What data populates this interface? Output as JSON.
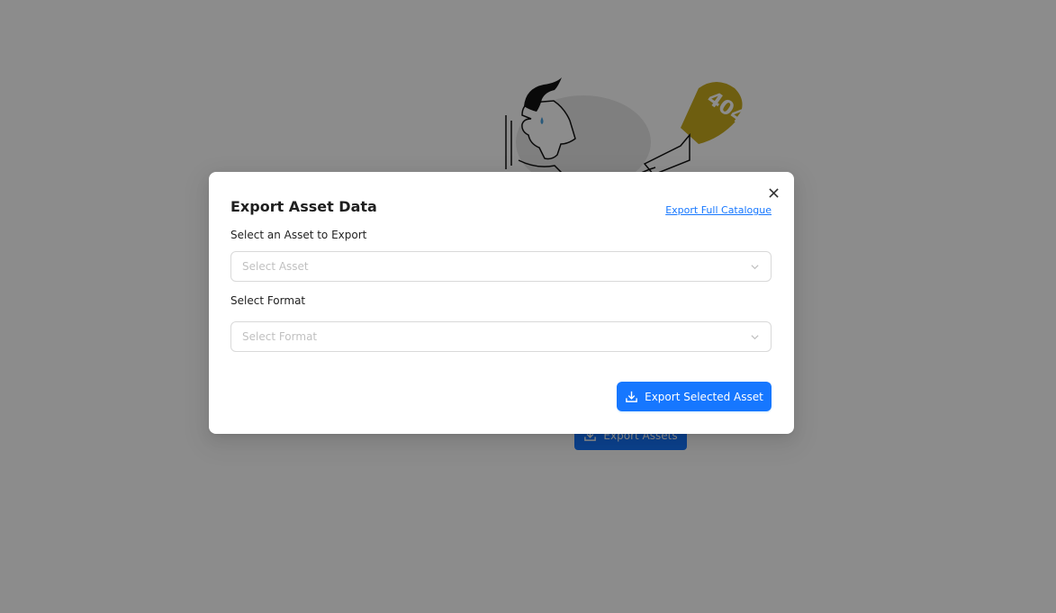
{
  "background": {
    "illustration_text": "404",
    "export_assets_label": "Export Assets",
    "export_icon": "download-icon"
  },
  "modal": {
    "title": "Export Asset Data",
    "full_catalogue_link": "Export Full Catalogue",
    "close_icon": "close-icon",
    "asset_field": {
      "label": "Select an Asset to Export",
      "placeholder": "Select Asset"
    },
    "format_field": {
      "label": "Select Format",
      "placeholder": "Select Format"
    },
    "export_selected_label": "Export Selected Asset",
    "export_icon": "download-icon"
  },
  "colors": {
    "primary": "#1677ff",
    "mask": "rgba(0,0,0,0.45)",
    "illustration_accent": "#f5d90a"
  }
}
